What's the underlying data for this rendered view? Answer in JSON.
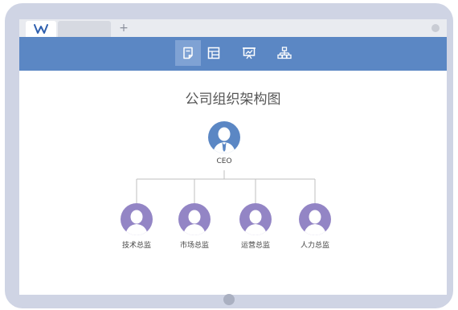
{
  "app": {
    "logo_icon": "wps-logo-icon",
    "new_tab_symbol": "+"
  },
  "toolbar": {
    "tools": [
      {
        "icon": "document-icon",
        "active": true
      },
      {
        "icon": "spreadsheet-icon",
        "active": false
      },
      {
        "icon": "presentation-icon",
        "active": false
      },
      {
        "icon": "org-chart-icon",
        "active": false
      }
    ],
    "accent_color": "#5b87c4"
  },
  "chart": {
    "title": "公司组织架构图",
    "ceo": {
      "label": "CEO",
      "color": "#5b87c4"
    },
    "directors": [
      {
        "label": "技术总监"
      },
      {
        "label": "市场总监"
      },
      {
        "label": "运营总监"
      },
      {
        "label": "人力总监"
      }
    ],
    "director_color": "#9385c5",
    "line_color": "#bfbfbf"
  }
}
